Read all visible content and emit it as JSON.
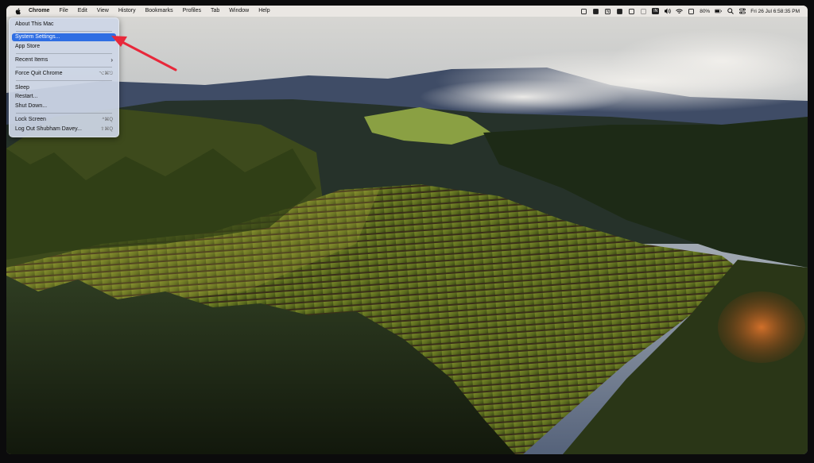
{
  "menubar": {
    "app_name": "Chrome",
    "items": [
      "File",
      "Edit",
      "View",
      "History",
      "Bookmarks",
      "Profiles",
      "Tab",
      "Window",
      "Help"
    ],
    "status": {
      "input_source": "IN",
      "battery": "80%",
      "datetime": "Fri 26 Jul  6:58:35 PM"
    }
  },
  "apple_menu": {
    "about": "About This Mac",
    "system_settings": "System Settings...",
    "app_store": "App Store",
    "recent_items": "Recent Items",
    "recent_arrow": "›",
    "force_quit": "Force Quit Chrome",
    "force_quit_shortcut": "⌥⌘⎋",
    "sleep": "Sleep",
    "restart": "Restart...",
    "shut_down": "Shut Down...",
    "lock_screen": "Lock Screen",
    "lock_shortcut": "^⌘Q",
    "log_out": "Log Out Shubham Davey...",
    "log_out_shortcut": "⇧⌘Q"
  },
  "colors": {
    "highlight": "#2f6ee3",
    "annotation_arrow": "#e8283a"
  },
  "icons": [
    "apple-icon",
    "magnifier-icon",
    "wifi-icon",
    "volume-icon",
    "battery-icon",
    "search-icon",
    "control-center-icon",
    "siri-icon"
  ]
}
